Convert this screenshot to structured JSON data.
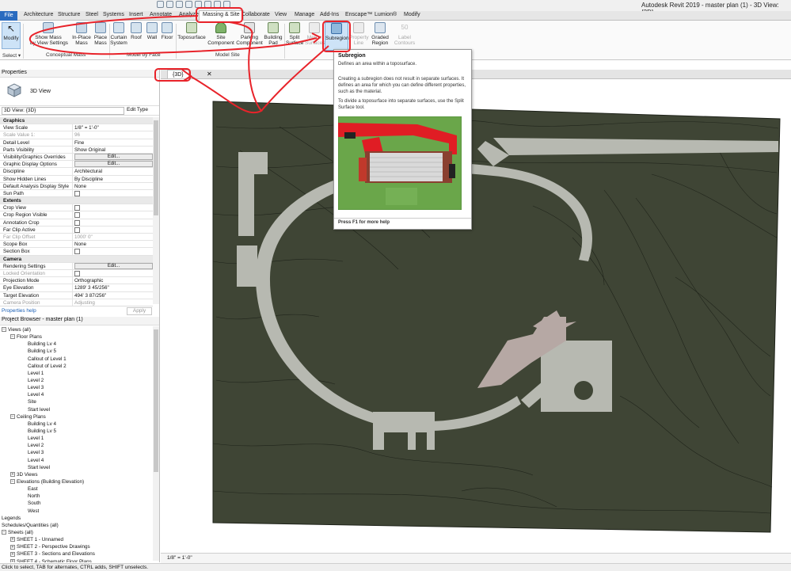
{
  "app": {
    "title": "Autodesk Revit 2019 - master plan (1) - 3D View: {3D}"
  },
  "tabs": [
    "File",
    "Architecture",
    "Structure",
    "Steel",
    "Systems",
    "Insert",
    "Annotate",
    "Analyze",
    "Massing & Site",
    "Collaborate",
    "View",
    "Manage",
    "Add-Ins",
    "Enscape™",
    "Lumion®",
    "Modify"
  ],
  "ribbon": {
    "modify": "Modify",
    "select": "Select ▾",
    "show_mass": "Show Mass\nby View Settings",
    "inplace_mass": "In-Place\nMass",
    "place_mass": "Place\nMass",
    "curtain_system": "Curtain\nSystem",
    "roof": "Roof",
    "wall": "Wall",
    "floor": "Floor",
    "toposurface": "Toposurface",
    "site_component": "Site\nComponent",
    "parking_component": "Parking\nComponent",
    "building_pad": "Building\nPad",
    "split_surface": "Split\nSurface",
    "merge_surfaces": "Merge\nSurfaces",
    "subregion": "Subregion",
    "property_line": "Property\nLine",
    "graded_region": "Graded\nRegion",
    "label_contours": "Label\nContours",
    "panel_conceptual": "Conceptual Mass",
    "panel_model_face": "Model by Face",
    "panel_model_site": "Model Site"
  },
  "properties": {
    "header": "Properties",
    "type_name": "3D View",
    "view_selector": "3D View: {3D}",
    "edit_type": "Edit Type",
    "rows": [
      {
        "group": "Graphics"
      },
      {
        "k": "View Scale",
        "v": "1/8\" = 1'-0\""
      },
      {
        "k": "Scale Value    1:",
        "v": "96",
        "dim": true
      },
      {
        "k": "Detail Level",
        "v": "Fine"
      },
      {
        "k": "Parts Visibility",
        "v": "Show Original"
      },
      {
        "k": "Visibility/Graphics Overrides",
        "btn": "Edit..."
      },
      {
        "k": "Graphic Display Options",
        "btn": "Edit..."
      },
      {
        "k": "Discipline",
        "v": "Architectural"
      },
      {
        "k": "Show Hidden Lines",
        "v": "By Discipline"
      },
      {
        "k": "Default Analysis Display Style",
        "v": "None"
      },
      {
        "k": "Sun Path",
        "cb": true
      },
      {
        "group": "Extents"
      },
      {
        "k": "Crop View",
        "cb": true
      },
      {
        "k": "Crop Region Visible",
        "cb": true
      },
      {
        "k": "Annotation Crop",
        "cb": true
      },
      {
        "k": "Far Clip Active",
        "cb": true
      },
      {
        "k": "Far Clip Offset",
        "v": "1000'  0\"",
        "dim": true
      },
      {
        "k": "Scope Box",
        "v": "None"
      },
      {
        "k": "Section Box",
        "cb": true
      },
      {
        "group": "Camera"
      },
      {
        "k": "Rendering Settings",
        "btn": "Edit..."
      },
      {
        "k": "Locked Orientation",
        "cb": true,
        "dim": true
      },
      {
        "k": "Projection Mode",
        "v": "Orthographic"
      },
      {
        "k": "Eye Elevation",
        "v": "1289'  3 45/256\""
      },
      {
        "k": "Target Elevation",
        "v": "494'  3 87/256\""
      },
      {
        "k": "Camera Position",
        "v": "Adjusting",
        "dim": true
      }
    ],
    "help": "Properties help",
    "apply": "Apply"
  },
  "browser": {
    "header": "Project Browser - master plan (1)",
    "nodes": [
      {
        "t": "Views (all)",
        "lvl": 0,
        "box": "−"
      },
      {
        "t": "Floor Plans",
        "lvl": 1,
        "box": "−"
      },
      {
        "t": "Building Lv 4",
        "lvl": 3
      },
      {
        "t": "Building Lv 5",
        "lvl": 3
      },
      {
        "t": "Callout of Level 1",
        "lvl": 3
      },
      {
        "t": "Callout of Level 2",
        "lvl": 3
      },
      {
        "t": "Level 1",
        "lvl": 3
      },
      {
        "t": "Level 2",
        "lvl": 3
      },
      {
        "t": "Level 3",
        "lvl": 3
      },
      {
        "t": "Level 4",
        "lvl": 3
      },
      {
        "t": "Site",
        "lvl": 3
      },
      {
        "t": "Start level",
        "lvl": 3
      },
      {
        "t": "Ceiling Plans",
        "lvl": 1,
        "box": "−"
      },
      {
        "t": "Building Lv 4",
        "lvl": 3
      },
      {
        "t": "Building Lv 5",
        "lvl": 3
      },
      {
        "t": "Level 1",
        "lvl": 3
      },
      {
        "t": "Level 2",
        "lvl": 3
      },
      {
        "t": "Level 3",
        "lvl": 3
      },
      {
        "t": "Level 4",
        "lvl": 3
      },
      {
        "t": "Start level",
        "lvl": 3
      },
      {
        "t": "3D Views",
        "lvl": 1,
        "box": "+"
      },
      {
        "t": "Elevations (Building Elevation)",
        "lvl": 1,
        "box": "−"
      },
      {
        "t": "East",
        "lvl": 3
      },
      {
        "t": "North",
        "lvl": 3
      },
      {
        "t": "South",
        "lvl": 3
      },
      {
        "t": "West",
        "lvl": 3
      },
      {
        "t": "Legends",
        "lvl": 0
      },
      {
        "t": "Schedules/Quantities (all)",
        "lvl": 0
      },
      {
        "t": "Sheets (all)",
        "lvl": 0,
        "box": "−"
      },
      {
        "t": "SHEET 1 - Unnamed",
        "lvl": 1,
        "box": "+"
      },
      {
        "t": "SHEET 2 - Perspective Drawings",
        "lvl": 1,
        "box": "+"
      },
      {
        "t": "SHEET 3 - Sections and Elevations",
        "lvl": 1,
        "box": "+"
      },
      {
        "t": "SHEET 4 - Schematic Floor Plans",
        "lvl": 1,
        "box": "+"
      }
    ]
  },
  "view_tab": {
    "label": "{3D}",
    "close": "✕"
  },
  "tooltip": {
    "title": "Subregion",
    "subtitle": "Defines an area within a toposurface.",
    "p1": "Creating a subregion does not result in separate surfaces. It defines an area for which you can define different properties, such as the material.",
    "p2": "To divide a toposurface into separate surfaces, use the Split Surface tool.",
    "footer": "Press F1 for more help"
  },
  "status": {
    "scale": "1/8\" = 1'-0\"",
    "hint": "Click to select, TAB for alternates, CTRL adds, SHIFT unselects."
  },
  "colors": {
    "terrain": "#3f4535",
    "terrain_line": "#1e2219",
    "path": "#b7b9b1",
    "pad": "#b6a8a4",
    "annotation": "#e8232a",
    "accent": "#2a6bbf"
  }
}
